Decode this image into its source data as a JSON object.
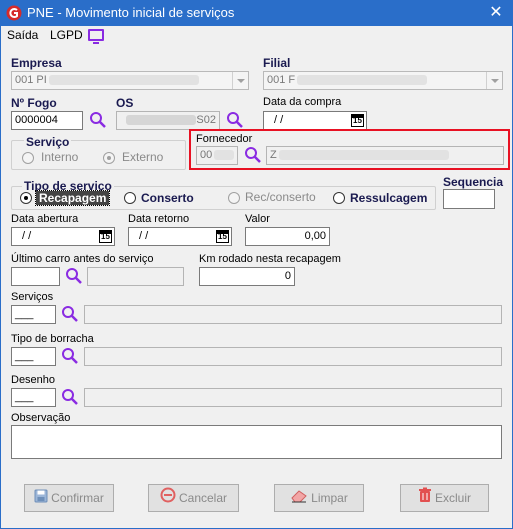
{
  "window": {
    "title": "PNE - Movimento inicial de serviços",
    "close_glyph": "✕"
  },
  "menu": {
    "saida": "Saída",
    "lgpd": "LGPD"
  },
  "empresa": {
    "label": "Empresa",
    "value": "001 PI"
  },
  "filial": {
    "label": "Filial",
    "value": "001 F"
  },
  "fogo": {
    "label": "Nº  Fogo",
    "value": "0000004"
  },
  "os": {
    "label": "OS",
    "value": "S02"
  },
  "data_compra": {
    "label": "Data da compra",
    "value": "/  /"
  },
  "servico": {
    "label": "Serviço",
    "interno": "Interno",
    "externo": "Externo",
    "selected": "externo"
  },
  "fornecedor": {
    "label": "Fornecedor",
    "code": "00",
    "name": "Z"
  },
  "tipo_servico": {
    "label": "Tipo de serviço",
    "options": [
      "Recapagem",
      "Conserto",
      "Rec/conserto",
      "Ressulcagem"
    ],
    "selected": "Recapagem"
  },
  "sequencia": {
    "label": "Sequencia",
    "value": ""
  },
  "data_abertura": {
    "label": "Data abertura",
    "value": "/  /"
  },
  "data_retorno": {
    "label": "Data retorno",
    "value": "/  /"
  },
  "valor": {
    "label": "Valor",
    "value": "0,00"
  },
  "ultimo_carro": {
    "label": "Último carro antes do serviço",
    "value": ""
  },
  "km_rodado": {
    "label": "Km rodado nesta recapagem",
    "value": "0"
  },
  "servicos": {
    "label": "Serviços",
    "code": "___",
    "desc": ""
  },
  "tipo_borracha": {
    "label": "Tipo de borracha",
    "code": "___",
    "desc": ""
  },
  "desenho": {
    "label": "Desenho",
    "code": "___",
    "desc": ""
  },
  "observacao": {
    "label": "Observação",
    "value": ""
  },
  "calendar_glyph": "15",
  "buttons": {
    "confirmar": "Confirmar",
    "cancelar": "Cancelar",
    "limpar": "Limpar",
    "excluir": "Excluir"
  },
  "colors": {
    "titlebar": "#2a6ec9",
    "accent": "#8a2be2",
    "highlight": "#e81123"
  }
}
